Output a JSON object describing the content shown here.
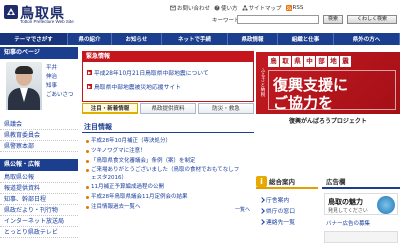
{
  "header": {
    "logo_text": "鳥取県",
    "logo_en": "Tottori Prefecture Web Site",
    "util_links": [
      "お問い合わせ",
      "使い方",
      "サイトマップ",
      "RSS"
    ],
    "keyword_label": "キーワード：",
    "search_button": "検索",
    "detail_button": "くわしく検索"
  },
  "gnav": [
    "テーマでさがす",
    "県の紹介",
    "お知らせ",
    "ネットで手続",
    "県政情報",
    "組織と仕事",
    "県外の方へ"
  ],
  "left": {
    "governor_head": "知事のページ",
    "governor_text": [
      "平井",
      "伸治",
      "知事",
      "ごあいさつ"
    ],
    "links": [
      "県議会",
      "県教育委員会",
      "県警察本部"
    ],
    "bousai_head": "県公報・広報",
    "bousai_links": [
      "鳥取県公報",
      "報道提供資料",
      "知事、幹部日程",
      "県政だより・刊行物",
      "インターネット放送局",
      "とっとり県政テレビ"
    ]
  },
  "center": {
    "kinkyu_head": "緊急情報",
    "kinkyu_items": [
      "平成28年10月21日鳥取県中部地震について",
      "鳥取県中部地震被災地応援サイト"
    ],
    "tabs": [
      "注目・新着情報",
      "県政提供資料",
      "防災・救急"
    ],
    "chumoku_head": "注目情報",
    "chumoku_items": [
      "平成28年10月補正（専決処分）",
      "ツキノワグマに注意！",
      "「鳥取県食文化審議会」条例（案）を制定",
      "ご来場ありがとうございました（鳥取の食材でおもてなしフェスタ2016）",
      "11月補正予算編成過程の公開",
      "平成28年鳥取県議会11月定例会の結果",
      "注目情報過去一覧へ"
    ],
    "more_link": "一覧へ"
  },
  "banner": {
    "sub_chars": [
      "鳥",
      "取",
      "県",
      "中",
      "部",
      "地",
      "震"
    ],
    "side_text": "ふるさと納税",
    "line1": "復興支援に",
    "line2": "ご協力を",
    "caption": "復興がんばろうプロジェクト"
  },
  "sogo": {
    "head": "総合案内",
    "icon": "i",
    "items": [
      "庁舎案内",
      "県庁の窓口",
      "連絡先一覧"
    ]
  },
  "ad": {
    "head": "広告欄",
    "img_title": "鳥取の魅力",
    "img_sub": "発見してください",
    "caption": "バナー広告の募集"
  },
  "colors": {
    "nav_blue": "#1c3e8f",
    "alert_red": "#c4161c",
    "accent_orange": "#e2a000"
  }
}
